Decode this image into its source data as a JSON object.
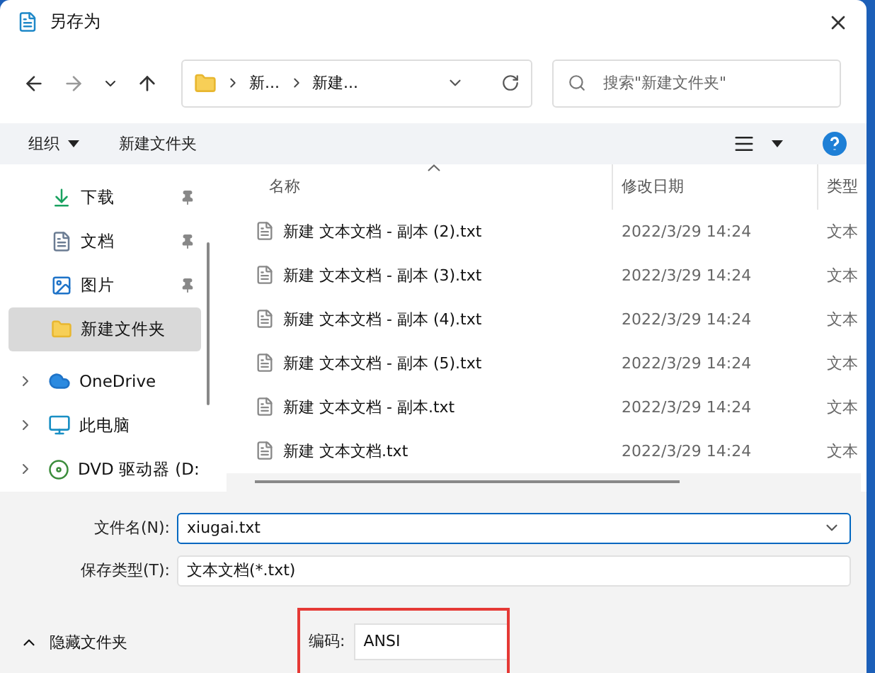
{
  "window": {
    "title": "另存为"
  },
  "address": {
    "crumbs": [
      "新...",
      "新建..."
    ]
  },
  "search": {
    "placeholder": "搜索\"新建文件夹\""
  },
  "toolbar": {
    "organize": "组织",
    "new_folder": "新建文件夹"
  },
  "sidebar": {
    "items": [
      {
        "label": "下载",
        "kind": "download",
        "pinned": true,
        "selected": false,
        "expandable": false
      },
      {
        "label": "文档",
        "kind": "document",
        "pinned": true,
        "selected": false,
        "expandable": false
      },
      {
        "label": "图片",
        "kind": "image",
        "pinned": true,
        "selected": false,
        "expandable": false
      },
      {
        "label": "新建文件夹",
        "kind": "folder",
        "pinned": false,
        "selected": true,
        "expandable": false
      },
      {
        "label": "OneDrive",
        "kind": "cloud",
        "pinned": false,
        "selected": false,
        "expandable": true
      },
      {
        "label": "此电脑",
        "kind": "computer",
        "pinned": false,
        "selected": false,
        "expandable": true
      },
      {
        "label": "DVD 驱动器 (D:",
        "kind": "disc",
        "pinned": false,
        "selected": false,
        "expandable": true
      }
    ]
  },
  "table": {
    "columns": [
      {
        "label": "名称",
        "sorted": true
      },
      {
        "label": "修改日期",
        "sorted": false
      },
      {
        "label": "类型",
        "sorted": false
      }
    ],
    "rows": [
      {
        "name": "新建 文本文档 - 副本 (2).txt",
        "date": "2022/3/29 14:24",
        "type": "文本"
      },
      {
        "name": "新建 文本文档 - 副本 (3).txt",
        "date": "2022/3/29 14:24",
        "type": "文本"
      },
      {
        "name": "新建 文本文档 - 副本 (4).txt",
        "date": "2022/3/29 14:24",
        "type": "文本"
      },
      {
        "name": "新建 文本文档 - 副本 (5).txt",
        "date": "2022/3/29 14:24",
        "type": "文本"
      },
      {
        "name": "新建 文本文档 - 副本.txt",
        "date": "2022/3/29 14:24",
        "type": "文本"
      },
      {
        "name": "新建 文本文档.txt",
        "date": "2022/3/29 14:24",
        "type": "文本"
      }
    ]
  },
  "form": {
    "filename_label": "文件名(N):",
    "filename": "xiugai.txt",
    "type_label": "保存类型(T):",
    "type": "文本文档(*.txt)"
  },
  "footer": {
    "toggle": "隐藏文件夹",
    "encoding_label": "编码:",
    "encoding": "ANSI",
    "highlighted": true
  }
}
